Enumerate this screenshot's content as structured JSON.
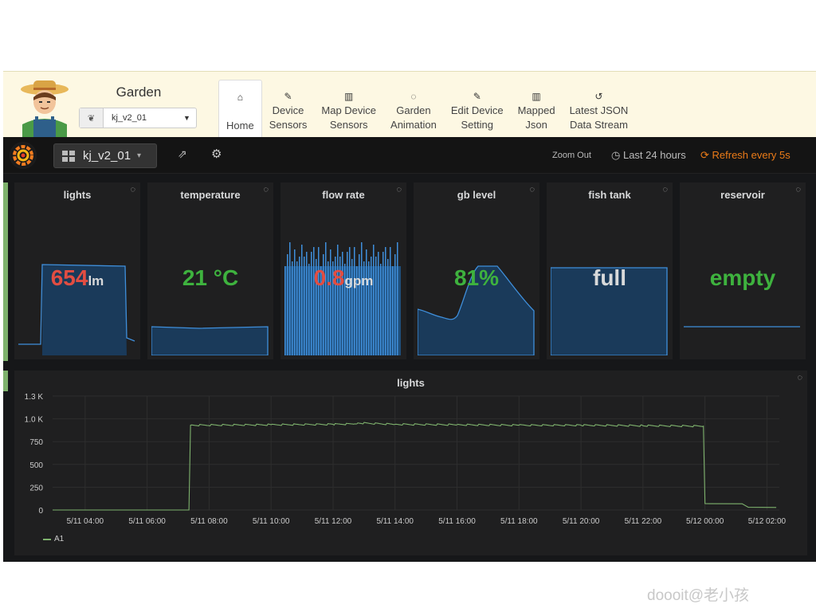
{
  "header": {
    "title": "Garden",
    "device_select": {
      "value": "kj_v2_01"
    },
    "nav": [
      {
        "icon": "home-icon",
        "glyph": "⌂",
        "label": "Home",
        "active": true
      },
      {
        "icon": "plug-icon",
        "glyph": "✎",
        "label": "Device\nSensors",
        "active": false
      },
      {
        "icon": "map-icon",
        "glyph": "▥",
        "label": "Map Device\nSensors",
        "active": false
      },
      {
        "icon": "spinner-icon",
        "glyph": "◌",
        "label": "Garden\nAnimation",
        "active": false
      },
      {
        "icon": "pencil-icon",
        "glyph": "✎",
        "label": "Edit Device\nSetting",
        "active": false
      },
      {
        "icon": "map-icon",
        "glyph": "▥",
        "label": "Mapped\nJson",
        "active": false
      },
      {
        "icon": "history-icon",
        "glyph": "↺",
        "label": "Latest JSON\nData Stream",
        "active": false
      }
    ]
  },
  "grafana_nav": {
    "dashboard": "kj_v2_01",
    "zoom_out": "Zoom Out",
    "time_range": "Last 24 hours",
    "refresh": "Refresh every 5s"
  },
  "stats": [
    {
      "title": "lights",
      "value": "654",
      "unit": "lm",
      "color": "#e24d42"
    },
    {
      "title": "temperature",
      "value": "21 °C",
      "unit": "",
      "color": "#3eb23e"
    },
    {
      "title": "flow rate",
      "value": "0.8",
      "unit": "gpm",
      "color": "#e24d42"
    },
    {
      "title": "gb level",
      "value": "81%",
      "unit": "",
      "color": "#3eb23e"
    },
    {
      "title": "fish tank",
      "value": "full",
      "unit": "",
      "color": "#d8d9da"
    },
    {
      "title": "reservoir",
      "value": "empty",
      "unit": "",
      "color": "#3eb23e"
    }
  ],
  "graph": {
    "title": "lights",
    "legend": "A1",
    "series_color": "#7eb26d"
  },
  "chart_data": {
    "type": "line",
    "title": "lights",
    "x_ticks": [
      "5/11 04:00",
      "5/11 06:00",
      "5/11 08:00",
      "5/11 10:00",
      "5/11 12:00",
      "5/11 14:00",
      "5/11 16:00",
      "5/11 18:00",
      "5/11 20:00",
      "5/11 22:00",
      "5/12 00:00",
      "5/12 02:00"
    ],
    "y_ticks": [
      "1.3 K",
      "1.0 K",
      "750",
      "500",
      "250",
      "0"
    ],
    "y_tick_values": [
      1250,
      1000,
      750,
      500,
      250,
      0
    ],
    "ylim": [
      0,
      1250
    ],
    "xlim_hours": [
      2.95,
      26.4
    ],
    "series": [
      {
        "name": "A1",
        "x_hours": [
          2.95,
          7.0,
          7.35,
          7.4,
          10,
          12,
          12.7,
          12.8,
          14,
          16,
          18,
          20,
          22,
          23.95,
          24.0,
          25.2,
          25.4,
          26.3
        ],
        "values": [
          0,
          0,
          0,
          930,
          935,
          940,
          945,
          955,
          940,
          935,
          930,
          930,
          925,
          920,
          70,
          68,
          30,
          28
        ]
      }
    ],
    "legend": "bottom-left",
    "grid": true
  },
  "watermark": "doooit@老小孩"
}
